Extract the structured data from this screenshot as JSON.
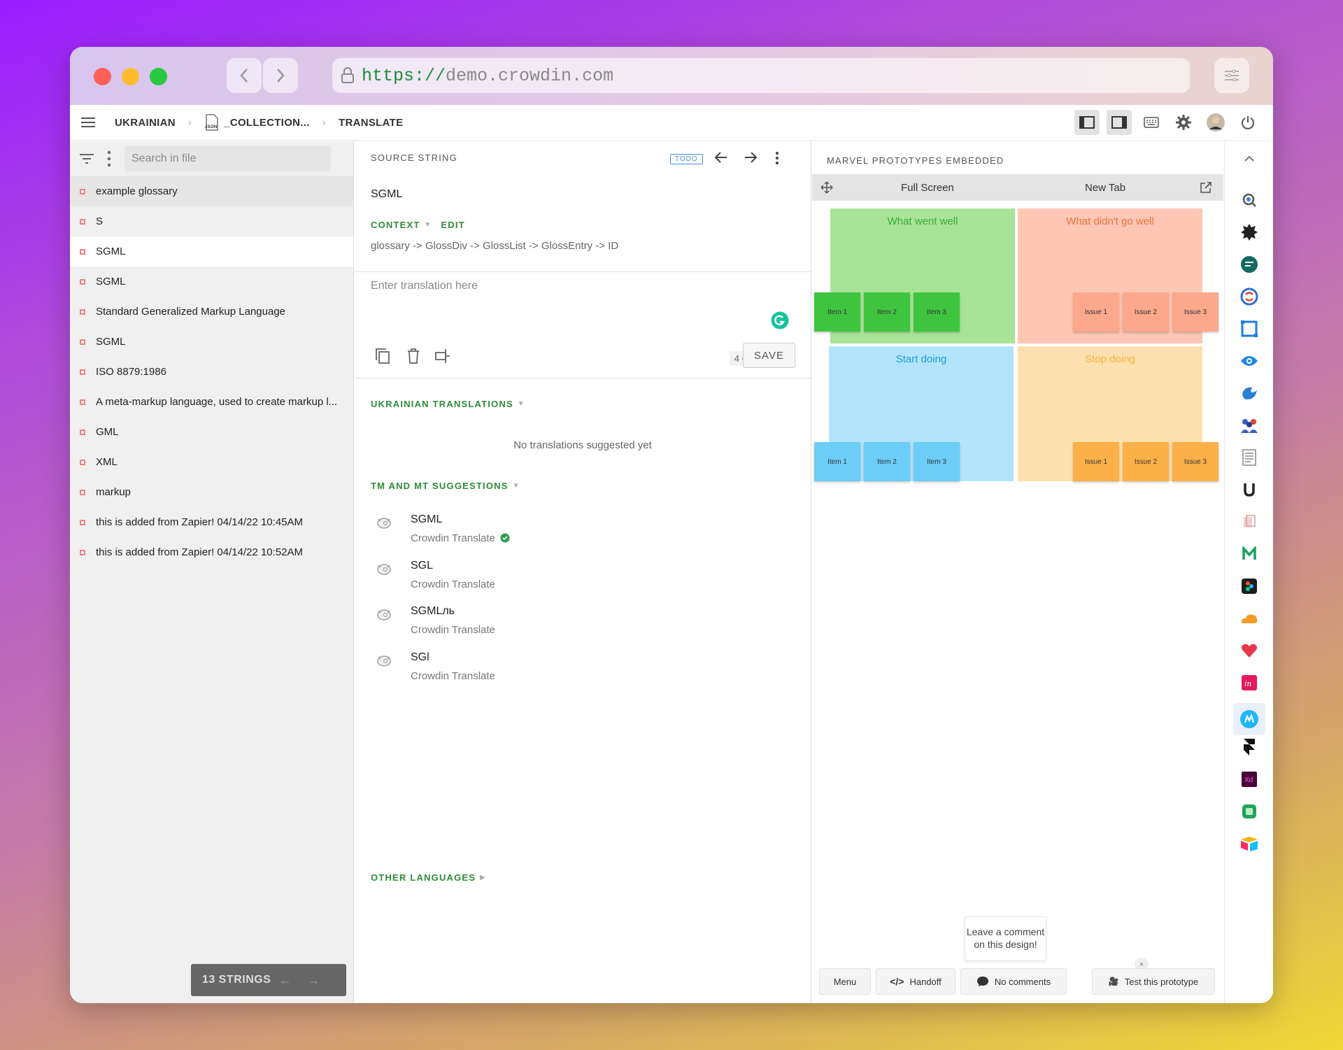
{
  "browser": {
    "url_scheme": "https://",
    "url_host": "demo.crowdin.com"
  },
  "breadcrumb": {
    "language": "UKRAINIAN",
    "file": "_COLLECTION...",
    "page": "TRANSLATE",
    "file_badge": "JSON"
  },
  "left": {
    "search_placeholder": "Search in file",
    "items": [
      "example glossary",
      "S",
      "SGML",
      "SGML",
      "Standard Generalized Markup Language",
      "SGML",
      "ISO 8879:1986",
      "A meta-markup language, used to create markup l...",
      "GML",
      "XML",
      "markup",
      "this is added from Zapier! 04/14/22 10:45AM",
      "this is added from Zapier! 04/14/22 10:52AM"
    ],
    "strings_count": "13 STRINGS",
    "nav_arrows": "←→"
  },
  "editor": {
    "source_label": "SOURCE STRING",
    "todo": "TODO",
    "source_text": "SGML",
    "context_label": "CONTEXT",
    "edit_label": "EDIT",
    "context_path": "glossary -> GlossDiv -> GlossList -> GlossEntry -> ID",
    "translation_placeholder": "Enter translation here",
    "counter": "4 • 0",
    "save": "SAVE",
    "ukr_translations_label": "UKRAINIAN TRANSLATIONS",
    "no_translations": "No translations suggested yet",
    "tm_label": "TM AND MT SUGGESTIONS",
    "suggestions": [
      {
        "text": "SGML",
        "source": "Crowdin Translate"
      },
      {
        "text": "SGL",
        "source": "Crowdin Translate"
      },
      {
        "text": "SGMLль",
        "source": "Crowdin Translate"
      },
      {
        "text": "SGl",
        "source": "Crowdin Translate"
      }
    ],
    "other_languages": "OTHER LANGUAGES"
  },
  "marvel": {
    "title": "MARVEL PROTOTYPES EMBEDDED",
    "full_screen": "Full Screen",
    "new_tab": "New Tab",
    "q1_title": "What went well",
    "q2_title": "What didn't go well",
    "q3_title": "Start doing",
    "q4_title": "Stop doing",
    "item1": "Item 1",
    "item2": "Item 2",
    "item3": "Item 3",
    "issue1": "Issue 1",
    "issue2": "Issue 2",
    "issue3": "Issue 3",
    "comment_prompt_1": "Leave a comment",
    "comment_prompt_2": "on this design!",
    "menu": "Menu",
    "handoff": "Handoff",
    "no_comments": "No comments",
    "test_prototype": "Test this prototype"
  },
  "colors": {
    "accent_green": "#2e8b3a",
    "grammarly": "#15c39a"
  }
}
